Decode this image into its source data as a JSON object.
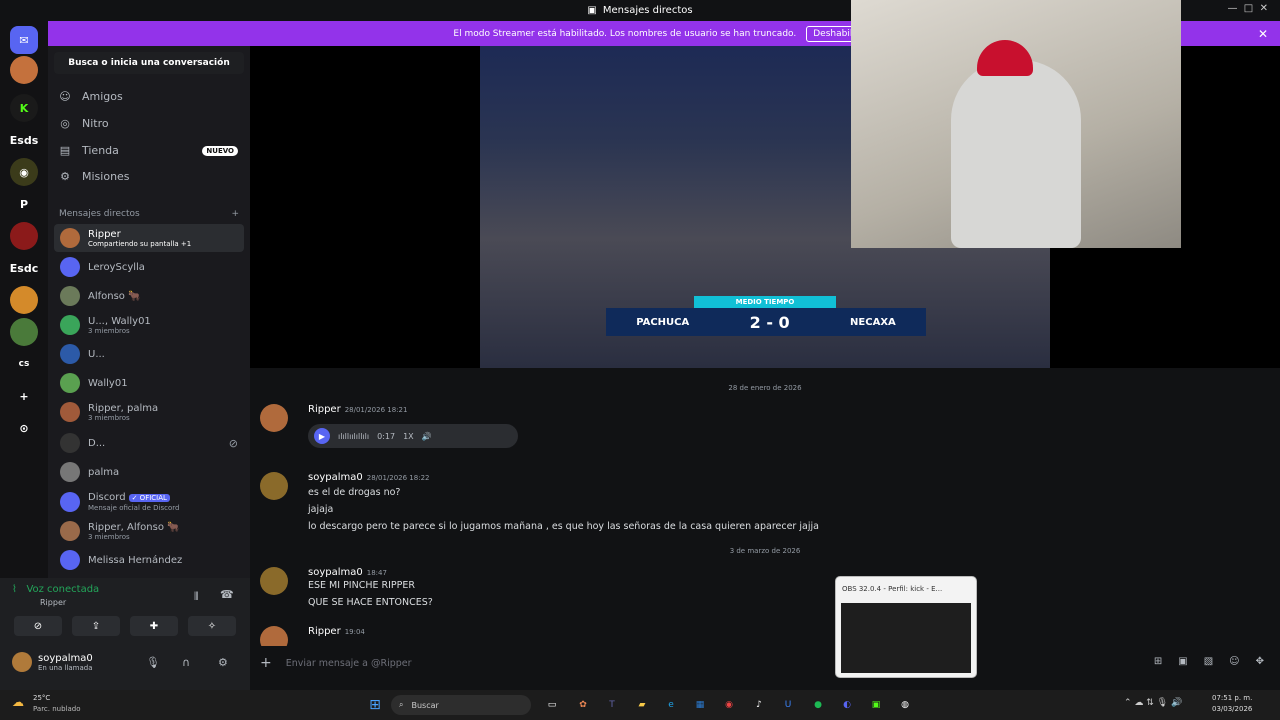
{
  "window": {
    "title": "Mensajes directos"
  },
  "banner": {
    "text": "El modo Streamer está habilitado. Los nombres de usuario se han truncado.",
    "button": "Deshabilitar"
  },
  "guilds": [
    "Esds",
    "P",
    "Esdc",
    "cs"
  ],
  "sidebar": {
    "search": "Busca o inicia una conversación",
    "nav": [
      {
        "label": "Amigos"
      },
      {
        "label": "Nitro"
      },
      {
        "label": "Tienda",
        "badge": "NUEVO"
      },
      {
        "label": "Misiones"
      }
    ],
    "section": "Mensajes directos",
    "dms": [
      {
        "name": "Ripper",
        "sub": "Compartiendo su pantalla +1"
      },
      {
        "name": "LeroyScylla",
        "sub": ""
      },
      {
        "name": "Alfonso 🐂",
        "sub": ""
      },
      {
        "name": "U..., Wally01",
        "sub": "3 miembros"
      },
      {
        "name": "U...",
        "sub": ""
      },
      {
        "name": "Wally01",
        "sub": ""
      },
      {
        "name": "Ripper, palma",
        "sub": "3 miembros"
      },
      {
        "name": "D...",
        "sub": ""
      },
      {
        "name": "palma",
        "sub": ""
      },
      {
        "name": "Discord",
        "sub": "Mensaje oficial de Discord",
        "badge": "✓ OFICIAL"
      },
      {
        "name": "Ripper, Alfonso 🐂",
        "sub": "3 miembros"
      },
      {
        "name": "Melissa Hernández",
        "sub": ""
      }
    ]
  },
  "voice": {
    "status": "Voz conectada",
    "channel": "Ripper"
  },
  "user": {
    "name": "soypalma0",
    "status": "En una llamada"
  },
  "stream": {
    "overlay_title": "MEDIO TIEMPO",
    "home": "PACHUCA",
    "away": "NECAXA",
    "score": "2 - 0"
  },
  "chat": {
    "date1": "28 de enero de 2026",
    "date2": "3 de marzo de 2026",
    "m1": {
      "author": "Ripper",
      "time": "28/01/2026 18:21",
      "duration": "0:17",
      "speed": "1X"
    },
    "m2": {
      "author": "soypalma0",
      "time": "28/01/2026 18:22",
      "lines": [
        "es el de drogas no?",
        "jajaja",
        "lo descargo pero te parece si lo jugamos mañana , es que hoy las señoras de la casa quieren aparecer jajja"
      ]
    },
    "m3": {
      "author": "soypalma0",
      "time": "18:47",
      "lines": [
        "ESE MI PINCHE RIPPER",
        "QUE SE HACE ENTONCES?"
      ]
    },
    "m4": {
      "author": "Ripper",
      "time": "19:04"
    }
  },
  "composer": {
    "placeholder": "Enviar mensaje a @Ripper"
  },
  "taskbar": {
    "weather_temp": "25°C",
    "weather_desc": "Parc. nublado",
    "search": "Buscar",
    "time": "07:51 p. m.",
    "date": "03/03/2026"
  },
  "obs": {
    "title": "OBS 32.0.4 - Perfil: kick - E..."
  }
}
